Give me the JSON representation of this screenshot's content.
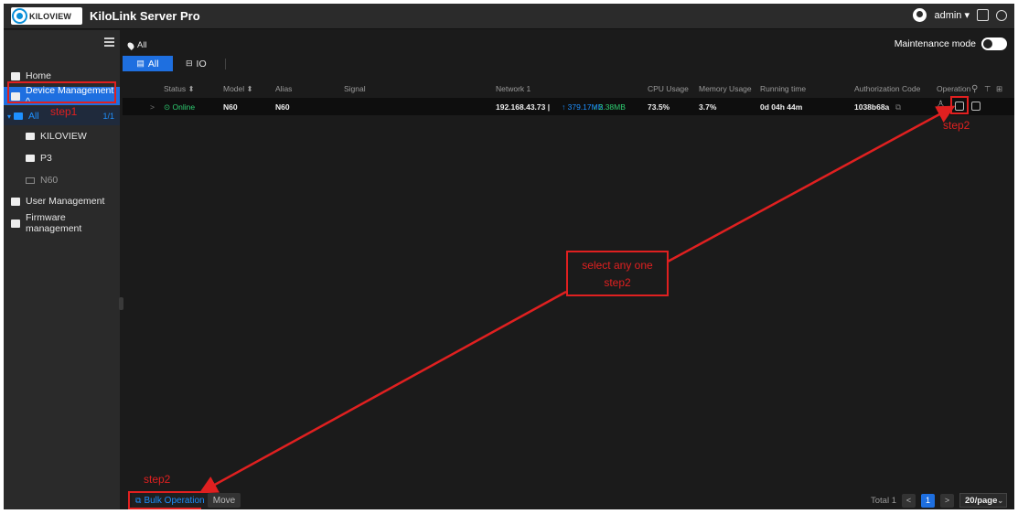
{
  "header": {
    "logo_text": "KILOVIEW",
    "app_title": "KiloLink Server Pro",
    "user": "admin ▾"
  },
  "sidebar": {
    "items": [
      {
        "label": "Home"
      },
      {
        "label": "Device Management ^"
      },
      {
        "label": "All"
      },
      {
        "label": "KILOVIEW"
      },
      {
        "label": "P3"
      },
      {
        "label": "N60"
      },
      {
        "label": "User Management"
      },
      {
        "label": "Firmware management"
      }
    ],
    "all_count": "1/1"
  },
  "main": {
    "breadcrumb": "All",
    "maintenance_label": "Maintenance mode",
    "tabs": [
      {
        "label": "All"
      },
      {
        "label": "IO"
      }
    ],
    "columns": [
      "Status ⬍",
      "Model ⬍",
      "Alias",
      "Signal",
      "Network 1",
      "CPU Usage",
      "Memory Usage",
      "Running time",
      "Authorization Code",
      "Operation"
    ],
    "row": {
      "expand": ">",
      "status": "⊙ Online",
      "model": "N60",
      "alias": "N60",
      "network_ip": "192.168.43.73 |",
      "network_up": "↑ 379.17MB",
      "network_down": "↓ 2.38MB",
      "cpu": "73.5%",
      "memory": "3.7%",
      "running_time": "0d 04h 44m",
      "auth_code": "1038b68a"
    }
  },
  "annotations": {
    "step1": "step1",
    "step2_op": "step2",
    "callout_line1": "select any one",
    "callout_line2": "step2",
    "step2_bulk": "step2"
  },
  "footer": {
    "bulk_label": "Bulk Operation",
    "move_label": "Move",
    "total": "Total 1",
    "prev": "<",
    "page": "1",
    "next": ">",
    "page_size": "20/page"
  },
  "colors": {
    "accent": "#1e6fe0",
    "annotation": "#e02020",
    "online": "#2ecc71"
  }
}
